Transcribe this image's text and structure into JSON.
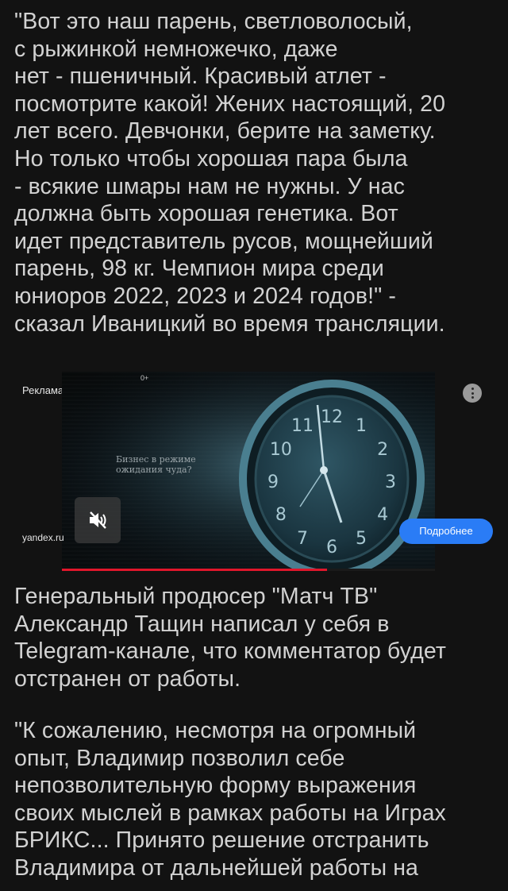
{
  "article": {
    "paragraph_1": "\"Вот это наш парень, светловолосый,\nс рыжинкой немножечко, даже\nнет - пшеничный. Красивый атлет -\nпосмотрите какой! Жених настоящий, 20\nлет всего. Девчонки, берите на заметку.\nНо только чтобы хорошая пара была\n- всякие шмары нам не нужны. У нас\nдолжна быть хорошая генетика. Вот\nидет представитель русов, мощнейший\nпарень, 98 кг. Чемпион мира среди\nюниоров 2022, 2023 и 2024 годов!\" -\nсказал Иваницкий во время трансляции.",
    "paragraph_2": "Генеральный продюсер \"Матч ТВ\"\nАлександр Тащин написал у себя в\nTelegram-канале, что комментатор будет\nотстранен от работы.",
    "paragraph_3": "\"К сожалению, несмотря на огромный\nопыт, Владимир позволил себе\nнепозволительную форму выражения\nсвоих мыслей в рамках работы на Играх\nБРИКС... Принято решение отстранить\nВладимира от дальнейшей работы на"
  },
  "ad": {
    "label": "Реклама",
    "age_rating": "0+",
    "domain": "yandex.ru",
    "caption": "Бизнес в режиме\nожидания чуда?",
    "cta_label": "Подробнее",
    "progress": 0.71,
    "accent_color": "#2a7cf6",
    "progress_color": "#e0162b",
    "mute_icon": "speaker-muted-icon",
    "more_icon": "more-vertical-icon",
    "clock_numerals": [
      "12",
      "1",
      "2",
      "3",
      "4",
      "5",
      "6",
      "7",
      "8",
      "9",
      "10",
      "11"
    ]
  }
}
